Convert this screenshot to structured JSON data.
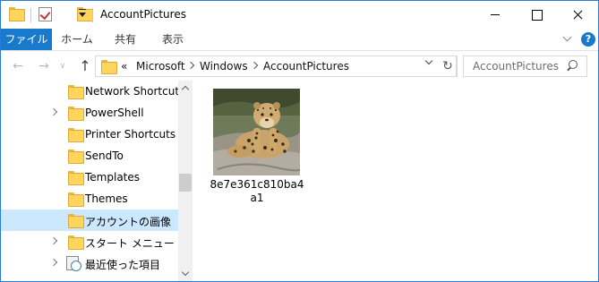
{
  "window": {
    "title": "AccountPictures"
  },
  "ribbon": {
    "tabs": [
      {
        "label": "ファイル"
      },
      {
        "label": "ホーム"
      },
      {
        "label": "共有"
      },
      {
        "label": "表示"
      }
    ],
    "help_label": "?"
  },
  "address_bar": {
    "overflow_label": "«",
    "breadcrumb": [
      {
        "label": "Microsoft"
      },
      {
        "label": "Windows"
      },
      {
        "label": "AccountPictures"
      }
    ]
  },
  "search": {
    "placeholder": "AccountPictures"
  },
  "nav_icons": {
    "back": "←",
    "forward": "→",
    "recent": "∨",
    "up": "↑",
    "refresh": "↻"
  },
  "navigation_pane": {
    "items": [
      {
        "label": "Network Shortcuts",
        "has_children": false,
        "selected": false,
        "icon": "folder-icon"
      },
      {
        "label": "PowerShell",
        "has_children": true,
        "selected": false,
        "icon": "folder-icon"
      },
      {
        "label": "Printer Shortcuts",
        "has_children": false,
        "selected": false,
        "icon": "folder-icon"
      },
      {
        "label": "SendTo",
        "has_children": false,
        "selected": false,
        "icon": "folder-icon"
      },
      {
        "label": "Templates",
        "has_children": false,
        "selected": false,
        "icon": "folder-icon"
      },
      {
        "label": "Themes",
        "has_children": false,
        "selected": false,
        "icon": "folder-icon"
      },
      {
        "label": "アカウントの画像",
        "has_children": false,
        "selected": true,
        "icon": "folder-icon"
      },
      {
        "label": "スタート メニュー",
        "has_children": true,
        "selected": false,
        "icon": "folder-icon"
      },
      {
        "label": "最近使った項目",
        "has_children": true,
        "selected": false,
        "icon": "recent-items-icon"
      }
    ]
  },
  "files": [
    {
      "name": "8e7e361c810ba4a1",
      "thumbnail": "leopard-photo"
    }
  ],
  "colors": {
    "accent": "#1979ca",
    "selection": "#cce8ff",
    "window_border": "#2b7bd4"
  }
}
